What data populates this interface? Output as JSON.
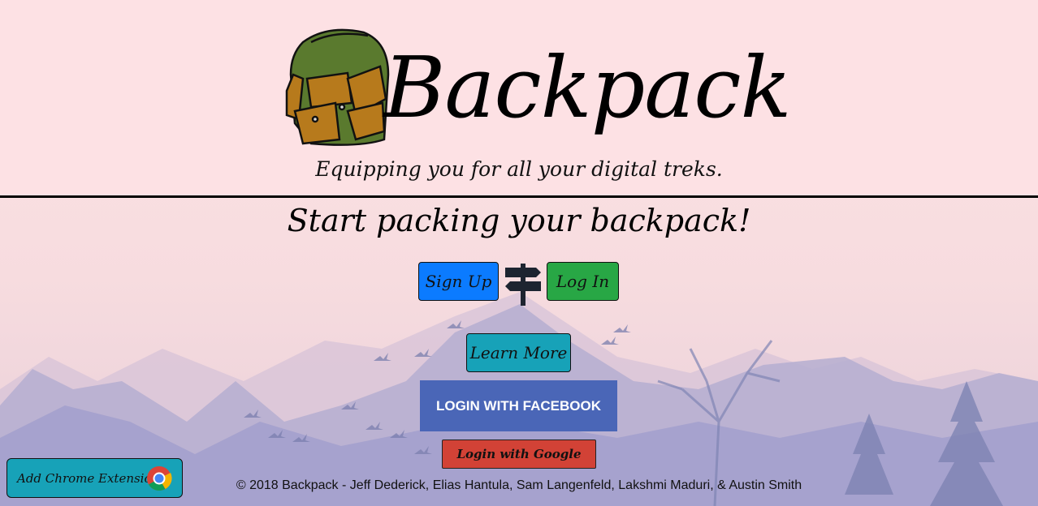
{
  "brand": {
    "title": "Backpack",
    "tagline": "Equipping you for all your digital treks."
  },
  "main": {
    "headline": "Start packing your backpack!",
    "signup_label": "Sign Up",
    "login_label": "Log In",
    "learn_more_label": "Learn More",
    "facebook_label": "LOGIN WITH FACEBOOK",
    "google_label": "Login with Google"
  },
  "extension": {
    "label": "Add Chrome Extension"
  },
  "footer": {
    "text": "© 2018 Backpack - Jeff Dederick, Elias Hantula, Sam Langenfeld, Lakshmi Maduri, & Austin Smith"
  },
  "colors": {
    "signup": "#0b7bff",
    "login": "#28a745",
    "learn_more": "#17a2b8",
    "facebook": "#4a66b7",
    "google": "#d24236"
  },
  "icons": {
    "logo": "backpack-icon",
    "signpost": "signpost-icon",
    "chrome": "chrome-icon"
  }
}
